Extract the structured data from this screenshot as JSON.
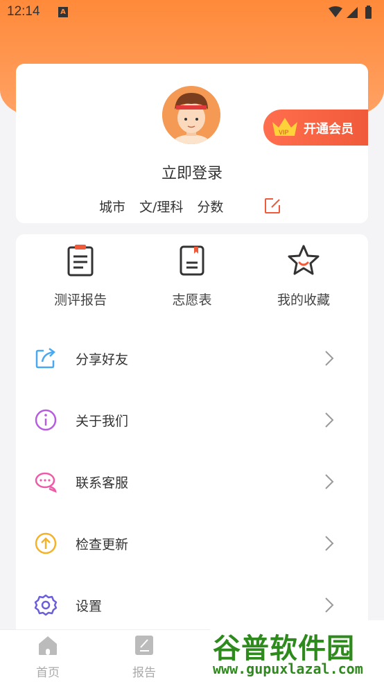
{
  "status_bar": {
    "time": "12:14",
    "notif": "A"
  },
  "profile": {
    "login_text": "立即登录",
    "city": "城市",
    "track": "文/理科",
    "score": "分数",
    "vip_label": "开通会员"
  },
  "quick_actions": [
    {
      "label": "测评报告",
      "icon": "report-icon"
    },
    {
      "label": "志愿表",
      "icon": "bookmark-doc-icon"
    },
    {
      "label": "我的收藏",
      "icon": "star-icon"
    }
  ],
  "menu_items": [
    {
      "label": "分享好友",
      "icon": "share-icon",
      "color": "#4aa8f0"
    },
    {
      "label": "关于我们",
      "icon": "info-icon",
      "color": "#b65ce0"
    },
    {
      "label": "联系客服",
      "icon": "chat-icon",
      "color": "#ee5aa8"
    },
    {
      "label": "检查更新",
      "icon": "upload-icon",
      "color": "#f3b22a"
    },
    {
      "label": "设置",
      "icon": "gear-icon",
      "color": "#6a5fd8"
    }
  ],
  "tabs": [
    {
      "label": "首页",
      "icon": "home-icon"
    },
    {
      "label": "报告",
      "icon": "report-tab-icon"
    }
  ],
  "watermark": {
    "title": "谷普软件园",
    "url": "www.gupuxlazal.com"
  },
  "colors": {
    "accent": "#ff8a3a",
    "vip": "#f05a3a",
    "edit": "#f05a3a"
  }
}
